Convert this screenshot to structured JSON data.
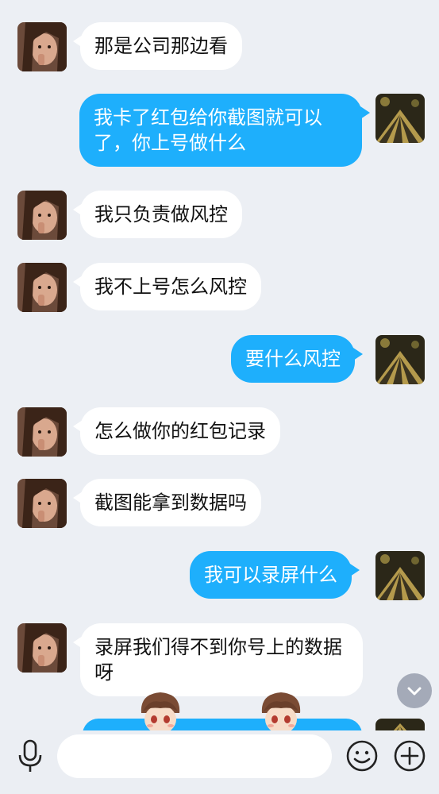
{
  "messages": [
    {
      "side": "in",
      "text": "那是公司那边看"
    },
    {
      "side": "out",
      "text": "我卡了红包给你截图就可以了，你上号做什么"
    },
    {
      "side": "in",
      "text": "我只负责做风控"
    },
    {
      "side": "in",
      "text": "我不上号怎么风控"
    },
    {
      "side": "out",
      "text": "要什么风控"
    },
    {
      "side": "in",
      "text": "怎么做你的红包记录"
    },
    {
      "side": "in",
      "text": "截图能拿到数据吗"
    },
    {
      "side": "out",
      "text": "我可以录屏什么"
    },
    {
      "side": "in",
      "text": "录屏我们得不到你号上的数据呀"
    }
  ],
  "input": {
    "placeholder": ""
  },
  "icons": {
    "voice": "microphone-icon",
    "emoji": "smiley-icon",
    "more": "plus-icon",
    "scroll": "chevron-down-icon"
  },
  "colors": {
    "background": "#eceff4",
    "incoming": "#ffffff",
    "outgoing": "#1eaffc",
    "scroll_button": "#a4aab8"
  }
}
